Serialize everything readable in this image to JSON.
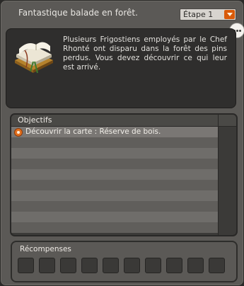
{
  "window": {
    "title": "Fantastique balade en forêt.",
    "step_select": "Étape 1",
    "description": "Plusieurs Frigostiens employés par le Chef Rhonté ont disparu dans la forêt des pins perdus. Vous devez découvrir ce qui leur est arrivé."
  },
  "objectives": {
    "header": "Objectifs",
    "items": [
      {
        "label": "Découvrir la carte : Réserve de bois."
      }
    ],
    "empty_rows": 9
  },
  "rewards": {
    "header": "Récompenses",
    "slots": 10
  },
  "colors": {
    "accent": "#d85a0a",
    "panel": "#2f2e2d",
    "window": "#5b5956"
  },
  "icons": [
    "book-icon",
    "chat-bubble-icon",
    "dropdown-arrow-icon",
    "objective-marker-icon"
  ]
}
